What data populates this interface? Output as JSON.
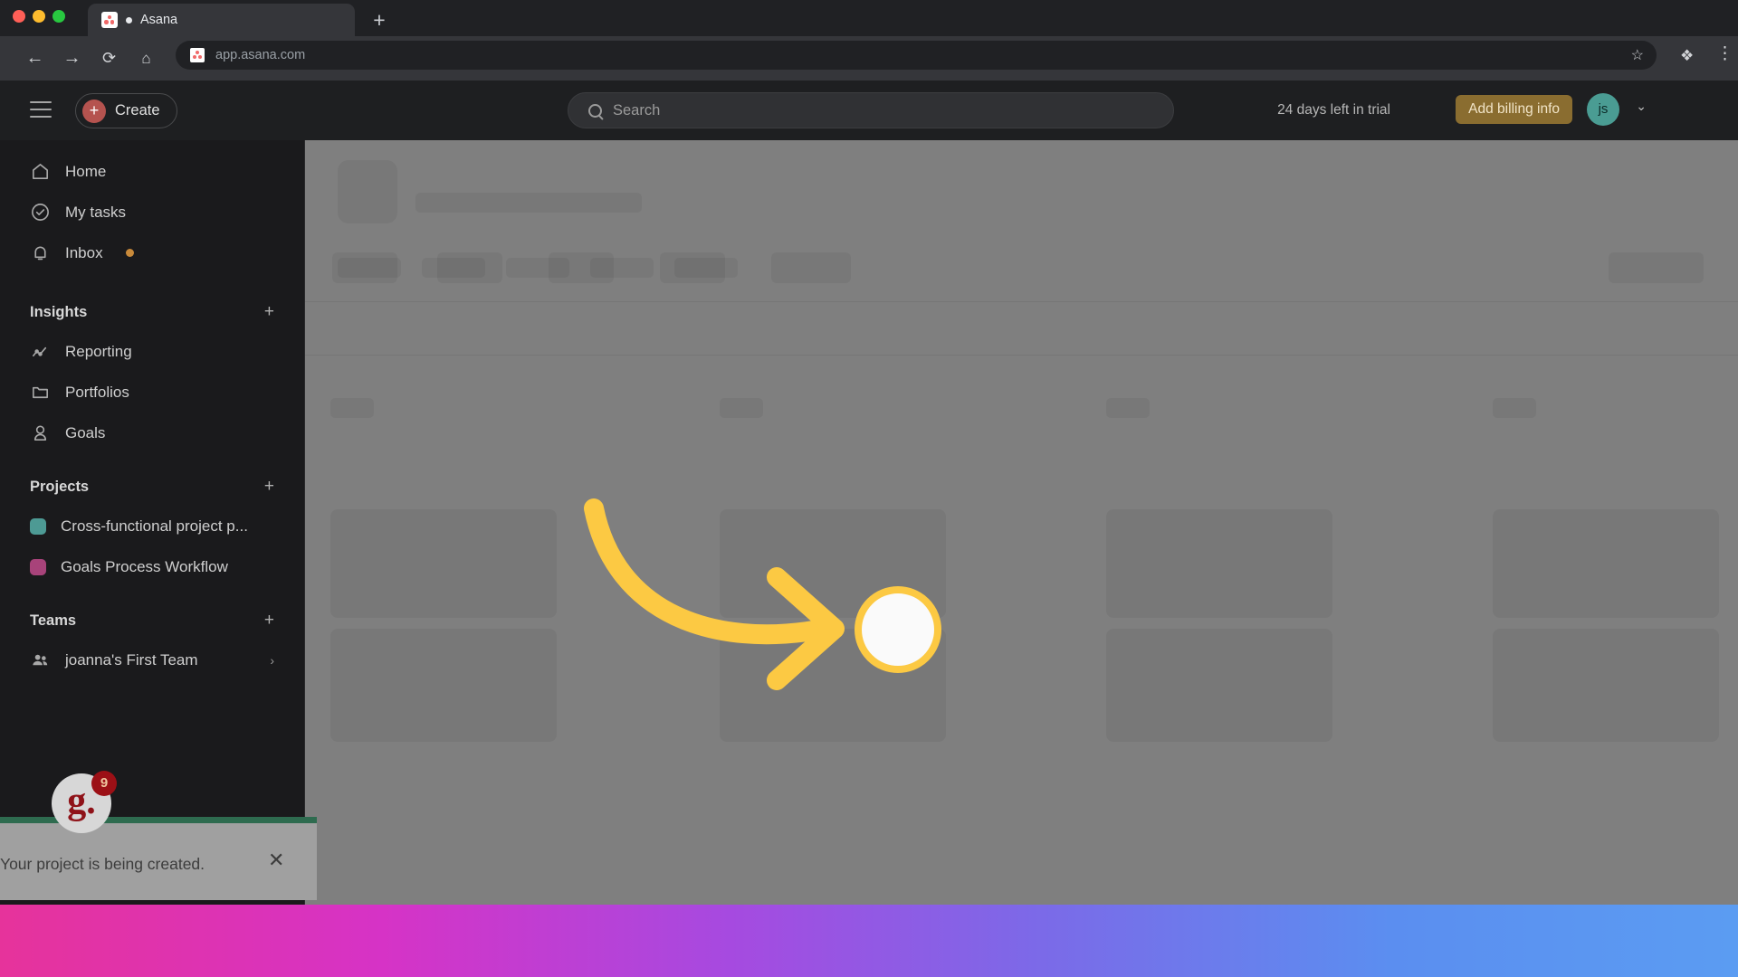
{
  "browser": {
    "tab": {
      "title": "Asana",
      "favicon": "asana-favicon",
      "audio_indicator": "●"
    },
    "new_tab_label": "+",
    "nav": {
      "back": "←",
      "forward": "→",
      "reload": "⟳",
      "home": "⌂"
    },
    "omnibox": {
      "url": "app.asana.com",
      "star": "☆"
    },
    "extensions_icon": "❖",
    "menu_icon": "⋮",
    "traffic_lights": {
      "close": "#ff5f57",
      "minimize": "#febc2e",
      "maximize": "#28c840"
    }
  },
  "topbar": {
    "menu_label": "",
    "create_label": "Create",
    "create_plus": "+",
    "search_placeholder": "Search",
    "trial_text": "24 days left in trial",
    "billing_label": "Add billing info",
    "avatar_initials": "js",
    "avatar_chevron": "⌄"
  },
  "sidebar": {
    "nav": [
      {
        "label": "Home",
        "icon": "home-icon"
      },
      {
        "label": "My tasks",
        "icon": "check-circle-icon"
      },
      {
        "label": "Inbox",
        "icon": "bell-icon",
        "badge": true
      }
    ],
    "insights": {
      "title": "Insights",
      "plus": "+",
      "items": [
        {
          "label": "Reporting",
          "icon": "line-chart-icon"
        },
        {
          "label": "Portfolios",
          "icon": "folder-icon"
        },
        {
          "label": "Goals",
          "icon": "goal-icon"
        }
      ]
    },
    "projects": {
      "title": "Projects",
      "plus": "+",
      "items": [
        {
          "label": "Cross-functional project p...",
          "color": "#4d9a94"
        },
        {
          "label": "Goals Process Workflow",
          "color": "#a8437a"
        }
      ]
    },
    "teams": {
      "title": "Teams",
      "plus": "+",
      "items": [
        {
          "label": "joanna's First Team",
          "icon": "people-icon",
          "chevron": "›"
        }
      ]
    }
  },
  "toast": {
    "message": "Your project is being created.",
    "close": "✕",
    "accent_color": "#2e6b4f",
    "logo_text": "g.",
    "logo_badge": "9"
  },
  "annotation": {
    "arrow_color": "#fcc943",
    "target_type": "click-target-circle"
  },
  "board_skeleton": {
    "tabs_count": 5,
    "toolbar_pills": 5,
    "columns": 4,
    "cards_per_column": 2
  }
}
